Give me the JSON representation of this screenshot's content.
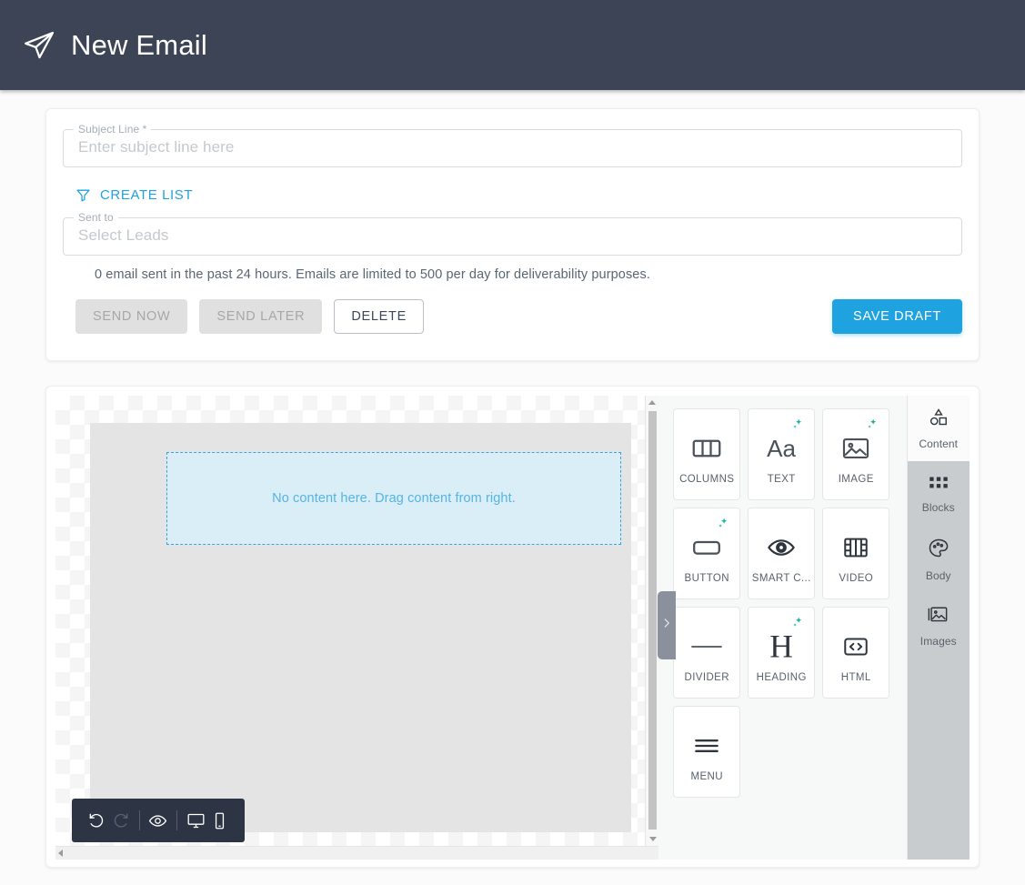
{
  "header": {
    "title": "New Email",
    "icon": "send-paper-plane-icon"
  },
  "form": {
    "subject": {
      "label": "Subject Line *",
      "placeholder": "Enter subject line here",
      "value": ""
    },
    "create_list": {
      "label": "CREATE LIST",
      "icon": "filter-funnel-icon"
    },
    "sent_to": {
      "label": "Sent to",
      "placeholder": "Select Leads",
      "value": ""
    },
    "limit_note": "0 email sent in the past 24 hours. Emails are limited to 500 per day for deliverability purposes.",
    "buttons": {
      "send_now": "SEND NOW",
      "send_later": "SEND LATER",
      "delete": "DELETE",
      "save_draft": "SAVE DRAFT"
    }
  },
  "editor": {
    "dropzone_text": "No content here. Drag content from right.",
    "toolbar": [
      {
        "name": "undo",
        "icon": "undo-arrow-icon",
        "enabled": true
      },
      {
        "name": "redo",
        "icon": "redo-arrow-icon",
        "enabled": false
      },
      {
        "name": "preview",
        "icon": "eye-icon",
        "enabled": true
      },
      {
        "name": "desktop",
        "icon": "desktop-monitor-icon",
        "enabled": true
      },
      {
        "name": "mobile",
        "icon": "mobile-phone-icon",
        "enabled": true
      }
    ],
    "collapse_handle": "chevron-right-icon",
    "palette": [
      {
        "label": "COLUMNS",
        "icon": "columns-icon",
        "ai": false
      },
      {
        "label": "TEXT",
        "icon": "text-aa-icon",
        "ai": true
      },
      {
        "label": "IMAGE",
        "icon": "image-icon",
        "ai": true
      },
      {
        "label": "BUTTON",
        "icon": "button-icon",
        "ai": true
      },
      {
        "label": "SMART C...",
        "icon": "smart-eye-icon",
        "ai": false
      },
      {
        "label": "VIDEO",
        "icon": "video-film-icon",
        "ai": false
      },
      {
        "label": "DIVIDER",
        "icon": "divider-line-icon",
        "ai": false
      },
      {
        "label": "HEADING",
        "icon": "heading-h-icon",
        "ai": true
      },
      {
        "label": "HTML",
        "icon": "code-brackets-icon",
        "ai": false
      },
      {
        "label": "MENU",
        "icon": "menu-lines-icon",
        "ai": false
      }
    ],
    "rail": [
      {
        "label": "Content",
        "icon": "shapes-icon",
        "active": true
      },
      {
        "label": "Blocks",
        "icon": "grid-dots-icon",
        "active": false
      },
      {
        "label": "Body",
        "icon": "palette-icon",
        "active": false
      },
      {
        "label": "Images",
        "icon": "images-icon",
        "active": false
      }
    ]
  },
  "colors": {
    "accent": "#1fa2e0",
    "header_bg": "#3d4456",
    "ai_badge": "#0fb49a"
  }
}
